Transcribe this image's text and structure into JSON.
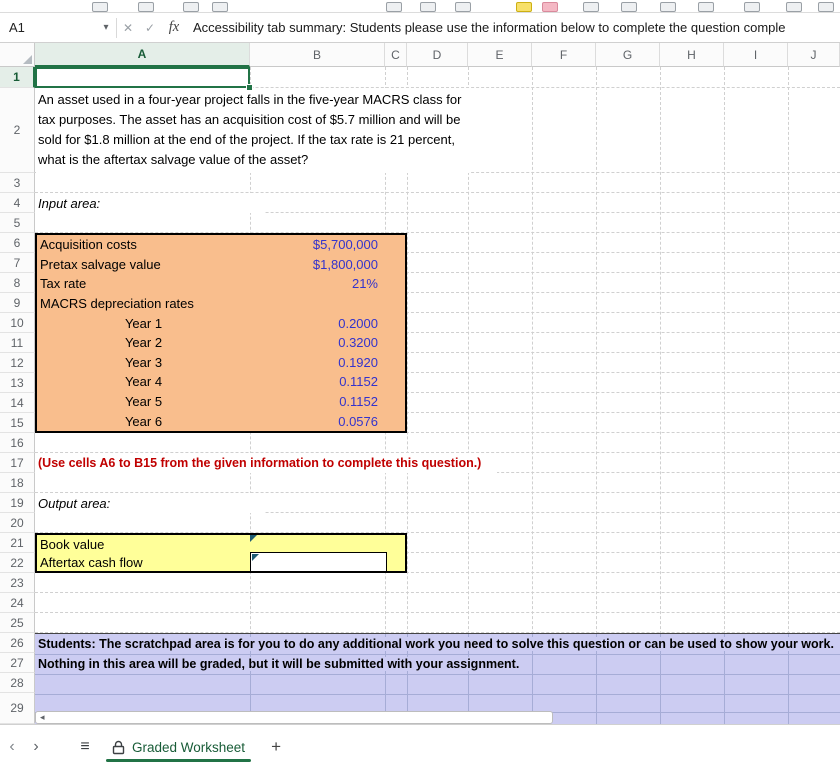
{
  "formula_bar": {
    "name_box_value": "A1",
    "fx_label": "fx",
    "formula_text": "Accessibility tab summary: Students please use the information below to complete the question comple"
  },
  "icons": {
    "name_box_caret": "▾",
    "cancel": "✕",
    "confirm": "✓",
    "scroll_left": "◂",
    "nav_prev": "‹",
    "nav_next": "›",
    "menu": "≡"
  },
  "grid": {
    "column_headers": [
      "A",
      "B",
      "C",
      "D",
      "E",
      "F",
      "G",
      "H",
      "I",
      "J"
    ],
    "row_headers": [
      "1",
      "2",
      "3",
      "4",
      "5",
      "6",
      "7",
      "8",
      "9",
      "10",
      "11",
      "12",
      "13",
      "14",
      "15",
      "16",
      "17",
      "18",
      "19",
      "20",
      "21",
      "22",
      "23",
      "24",
      "25",
      "26",
      "27",
      "28",
      "29"
    ]
  },
  "cells": {
    "question": "An asset used in a four-year project falls in the five-year MACRS class for tax purposes. The asset has an acquisition cost of $5.7 million and will be sold for $1.8 million at the end of the project. If the tax rate is 21 percent, what is the aftertax salvage value of the asset?",
    "input_area_label": "Input area:",
    "input_table": {
      "rows": [
        {
          "label": "Acquisition costs",
          "value": "$5,700,000"
        },
        {
          "label": "Pretax salvage value",
          "value": "$1,800,000"
        },
        {
          "label": "Tax rate",
          "value": "21%"
        },
        {
          "label": "MACRS depreciation rates",
          "value": ""
        },
        {
          "label": "Year 1",
          "value": "0.2000"
        },
        {
          "label": "Year 2",
          "value": "0.3200"
        },
        {
          "label": "Year 3",
          "value": "0.1920"
        },
        {
          "label": "Year 4",
          "value": "0.1152"
        },
        {
          "label": "Year 5",
          "value": "0.1152"
        },
        {
          "label": "Year 6",
          "value": "0.0576"
        }
      ]
    },
    "instruction": "(Use cells A6 to B15 from the given information to complete this question.)",
    "output_area_label": "Output area:",
    "output_table": {
      "rows": [
        {
          "label": "Book value"
        },
        {
          "label": "Aftertax cash flow"
        }
      ]
    },
    "scratchpad_line1": "Students: The scratchpad area is for you to do any additional work you need to solve this question or can be used to show your work.",
    "scratchpad_line2": "Nothing in this area will be graded, but it will be submitted with your assignment."
  },
  "sheet_bar": {
    "tab_label": "Graded Worksheet",
    "add_tab_label": "+"
  },
  "colors": {
    "input_fill": "#F9BE8D",
    "output_fill": "#FFFF99",
    "scratchpad_fill": "#CCCCF2",
    "value_blue": "#3333CC",
    "instruction_red": "#C00000",
    "selection_green": "#217346"
  }
}
